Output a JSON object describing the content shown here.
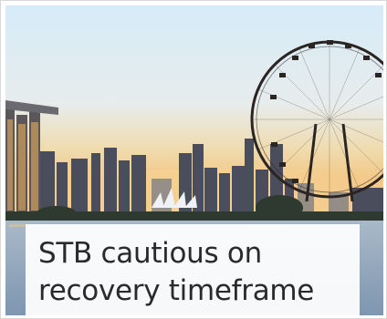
{
  "article": {
    "headline_lines": [
      "STB cautious on",
      "recovery timeframe"
    ]
  },
  "image": {
    "subject": "Singapore skyline with Marina Bay Sands and Singapore Flyer at dusk",
    "colors": {
      "sky_top": "#dfeef9",
      "sky_mid": "#e9e6da",
      "sky_warm": "#f1cf8a",
      "water": "#8fa8c2",
      "buildings": "#3b3d4a",
      "flyer": "#2a2422"
    }
  }
}
